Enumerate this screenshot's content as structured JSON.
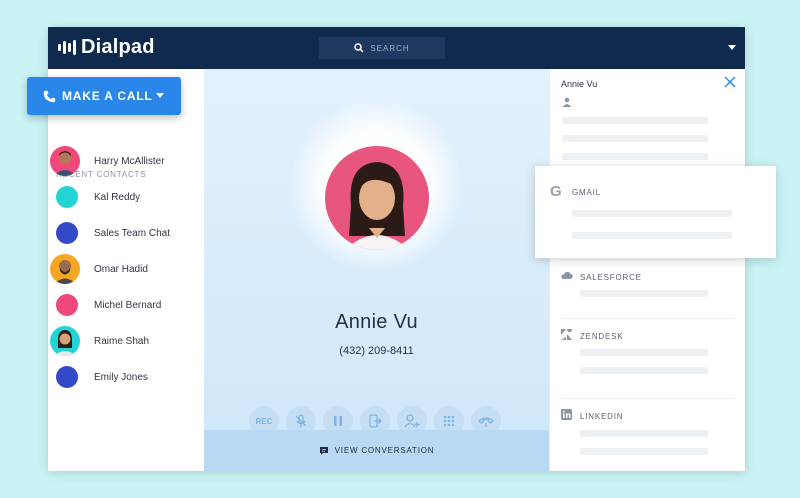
{
  "app": {
    "brand": "Dialpad"
  },
  "search": {
    "placeholder": "SEARCH"
  },
  "call_button": {
    "label": "MAKE A CALL"
  },
  "sidebar": {
    "recent_label": "RECENT CONTACTS",
    "contacts": [
      {
        "name": "Harry McAllister",
        "avatar": "photo",
        "color": "#f0487a"
      },
      {
        "name": "Kal Reddy",
        "avatar": "dot",
        "color": "#23d4d6"
      },
      {
        "name": "Sales Team Chat",
        "avatar": "dot",
        "color": "#3449c8"
      },
      {
        "name": "Omar Hadid",
        "avatar": "photo",
        "color": "#f5a623"
      },
      {
        "name": "Michel Bernard",
        "avatar": "dot",
        "color": "#f0487a"
      },
      {
        "name": "Raime Shah",
        "avatar": "photo",
        "color": "#23d4d6"
      },
      {
        "name": "Emily Jones",
        "avatar": "dot",
        "color": "#3449c8"
      }
    ]
  },
  "call": {
    "name": "Annie Vu",
    "number": "(432) 209-8411",
    "rec_label": "REC",
    "view_conversation": "VIEW CONVERSATION"
  },
  "right_panel": {
    "contact_name": "Annie Vu",
    "integrations": {
      "gmail": "GMAIL",
      "salesforce": "SALESFORCE",
      "zendesk": "ZENDESK",
      "linkedin": "LINKEDIN"
    }
  },
  "colors": {
    "topbar": "#0f2a4d",
    "accent": "#2a86e8",
    "background": "#c9f3f4"
  }
}
